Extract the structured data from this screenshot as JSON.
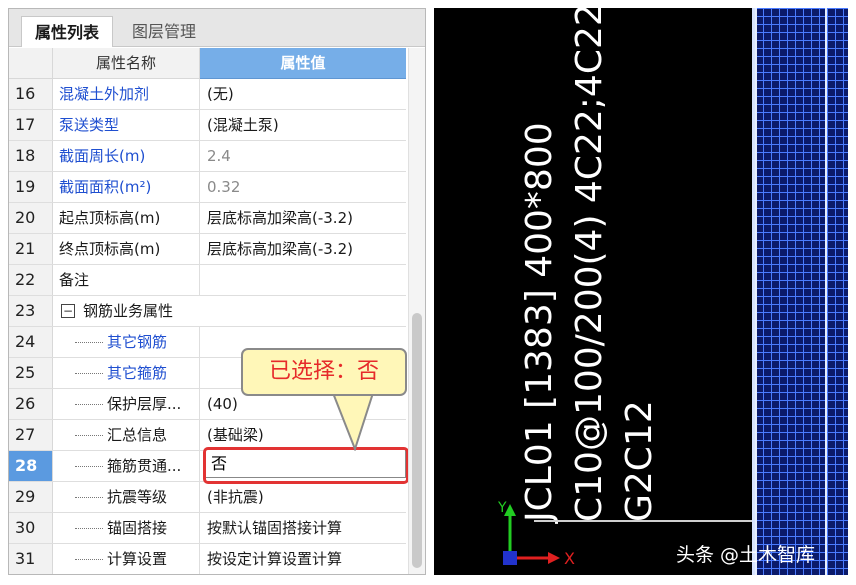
{
  "panel": {
    "tabs": [
      {
        "label": "属性列表",
        "active": true
      },
      {
        "label": "图层管理",
        "active": false
      }
    ],
    "headers": {
      "name": "属性名称",
      "value": "属性值"
    },
    "rows": [
      {
        "num": "16",
        "name": "混凝土外加剂",
        "value": "(无)"
      },
      {
        "num": "17",
        "name": "泵送类型",
        "value": "(混凝土泵)"
      },
      {
        "num": "18",
        "name": "截面周长(m)",
        "value": "2.4"
      },
      {
        "num": "19",
        "name": "截面面积(m²)",
        "value": "0.32"
      },
      {
        "num": "20",
        "name": "起点顶标高(m)",
        "value": "层底标高加梁高(-3.2)"
      },
      {
        "num": "21",
        "name": "终点顶标高(m)",
        "value": "层底标高加梁高(-3.2)"
      },
      {
        "num": "22",
        "name": "备注",
        "value": ""
      },
      {
        "num": "23",
        "name": "钢筋业务属性",
        "value": ""
      },
      {
        "num": "24",
        "name": "其它钢筋",
        "value": ""
      },
      {
        "num": "25",
        "name": "其它箍筋",
        "value": ""
      },
      {
        "num": "26",
        "name": "保护层厚...",
        "value": "(40)"
      },
      {
        "num": "27",
        "name": "汇总信息",
        "value": "(基础梁)"
      },
      {
        "num": "28",
        "name": "箍筋贯通...",
        "value": "否"
      },
      {
        "num": "29",
        "name": "抗震等级",
        "value": "(非抗震)"
      },
      {
        "num": "30",
        "name": "锚固搭接",
        "value": "按默认锚固搭接计算"
      },
      {
        "num": "31",
        "name": "计算设置",
        "value": "按设定计算设置计算"
      }
    ],
    "group_toggle": "−",
    "callout": "已选择：否"
  },
  "cad": {
    "line1": "JCL01 [1383] 400*800",
    "line2": "C10@100/200(4) 4C22;4C22",
    "line3": "G2C12",
    "axis_x": "X",
    "axis_y": "Y"
  },
  "watermark": "头条 @土木智库",
  "colors": {
    "header_value_bg": "#76aee8",
    "selected_row": "#5b9ae0",
    "highlight_frame": "#e23333",
    "callout_bg": "#fff7b8",
    "callout_text": "#e62a2a",
    "link_text": "#1f4fd0",
    "cad_background": "#000000",
    "cad_grid": "#4a7bff"
  }
}
